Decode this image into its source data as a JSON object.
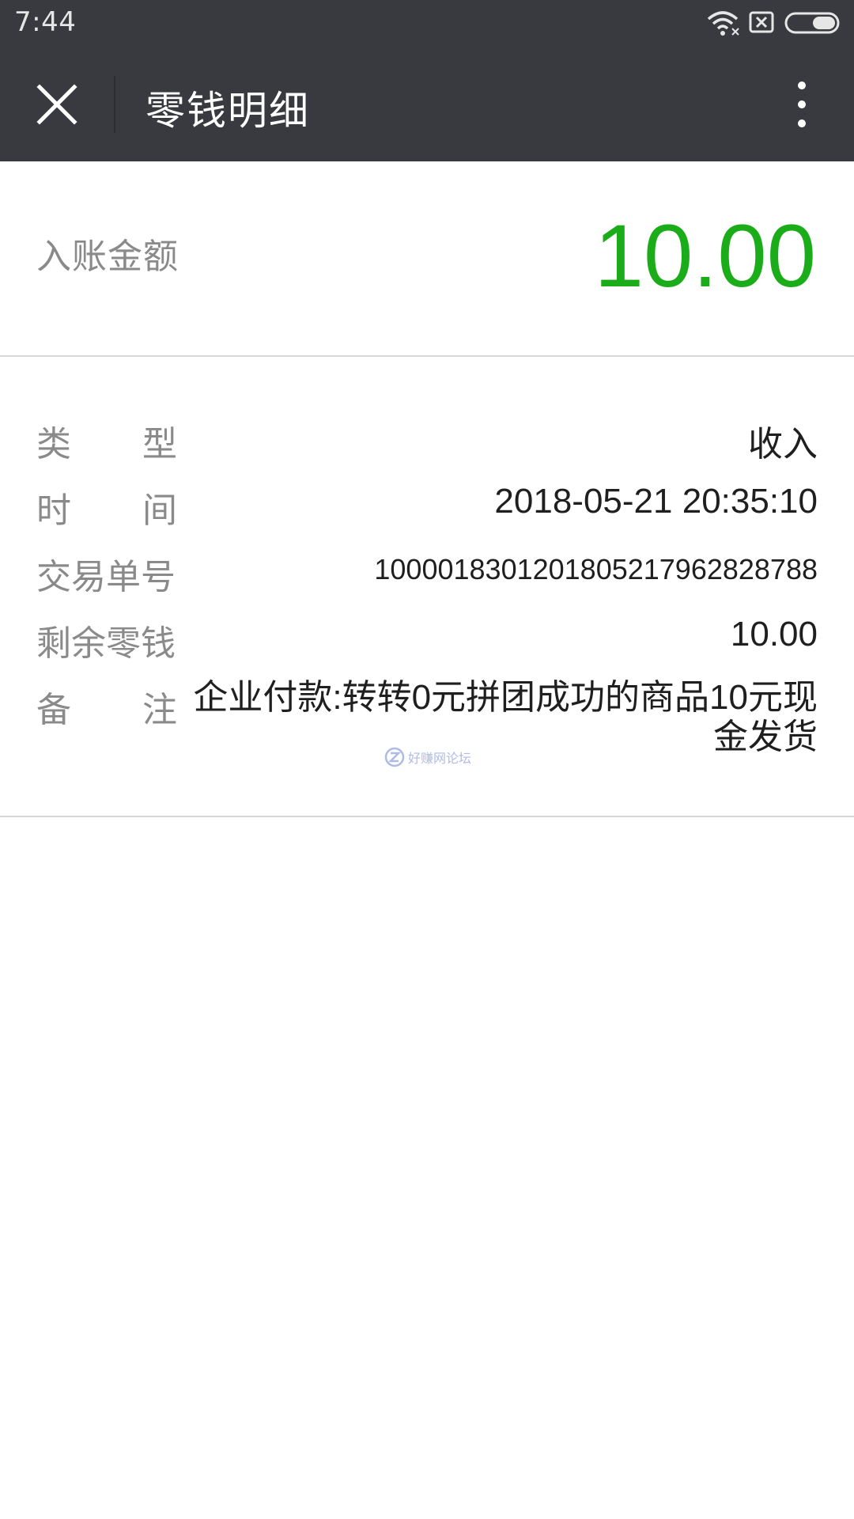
{
  "status_bar": {
    "time": "7:44",
    "icons": [
      "wifi-icon",
      "no-sim-icon",
      "battery-icon"
    ]
  },
  "title_bar": {
    "title": "零钱明细",
    "close_icon": "close-icon",
    "more_icon": "more-vertical-icon"
  },
  "amount": {
    "label": "入账金额",
    "value": "10.00",
    "color": "#1aad19"
  },
  "details": {
    "type": {
      "label_chars": [
        "类",
        "型"
      ],
      "value": "收入"
    },
    "time": {
      "label_chars": [
        "时",
        "间"
      ],
      "value": "2018-05-21 20:35:10"
    },
    "order_no": {
      "label": "交易单号",
      "value": "1000018301201805217962828788"
    },
    "balance": {
      "label": "剩余零钱",
      "value": "10.00"
    },
    "note": {
      "label_chars": [
        "备",
        "注"
      ],
      "value": "企业付款:转转0元拼团成功的商品10元现金发货"
    }
  },
  "watermark": {
    "text": "好赚网论坛",
    "icon": "z-logo-icon"
  },
  "colors": {
    "header_bg": "#393a3f",
    "accent_green": "#1aad19",
    "label_gray": "#8a8a8a"
  }
}
